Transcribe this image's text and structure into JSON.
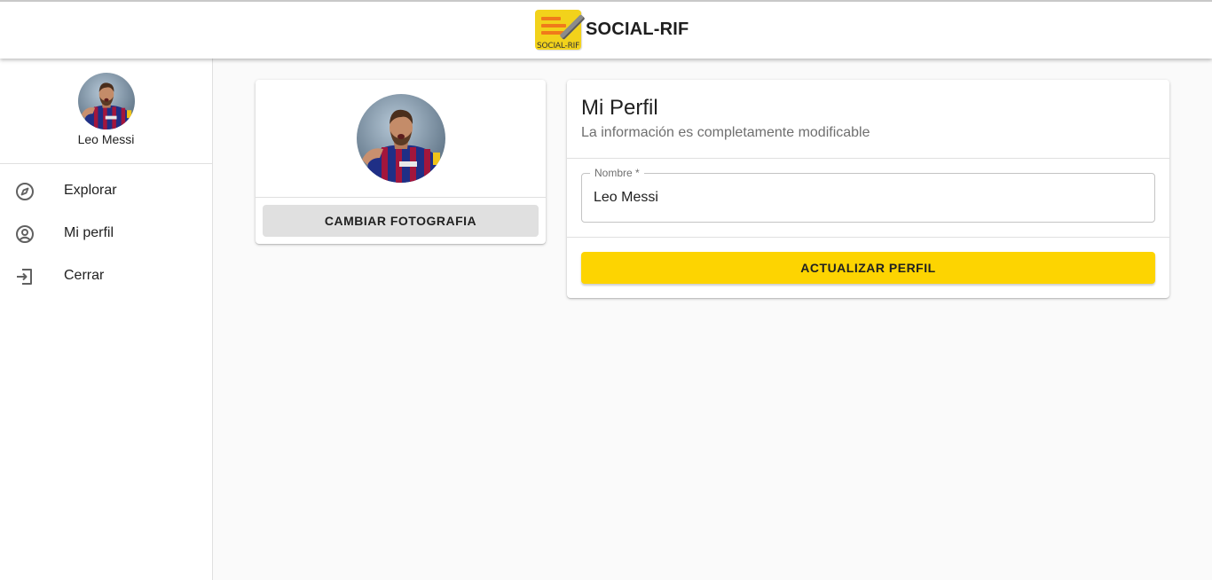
{
  "header": {
    "title": "SOCIAL-RIF",
    "logo_caption": "SOCIAL-RIF",
    "logo_icon": "notepad-pencil-logo",
    "logo_color": "#f2d21b"
  },
  "sidebar": {
    "user_name": "Leo Messi",
    "items": [
      {
        "label": "Explorar",
        "icon": "compass-icon"
      },
      {
        "label": "Mi perfil",
        "icon": "account-circle-icon"
      },
      {
        "label": "Cerrar",
        "icon": "logout-icon"
      }
    ]
  },
  "photo_card": {
    "change_photo_label": "CAMBIAR FOTOGRAFIA"
  },
  "profile_form": {
    "title": "Mi Perfil",
    "subtitle": "La información es completamente modificable",
    "name_label": "Nombre *",
    "name_value": "Leo Messi",
    "submit_label": "ACTUALIZAR PERFIL"
  },
  "colors": {
    "accent": "#fdd401",
    "secondary_button": "#e0e0e0",
    "background": "#fafafa"
  }
}
